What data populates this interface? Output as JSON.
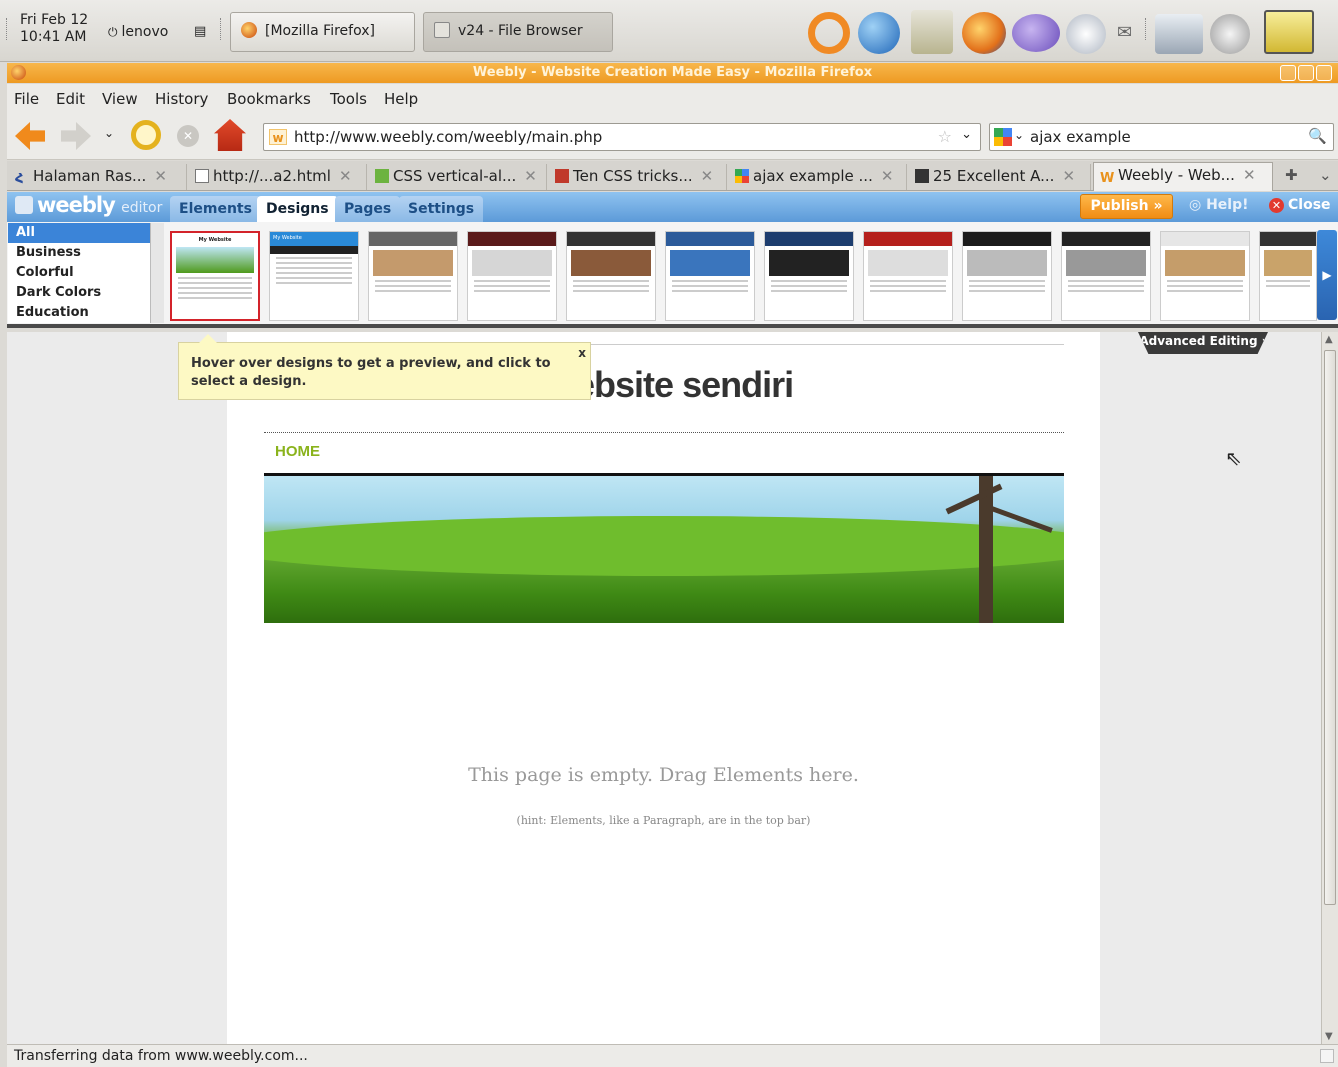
{
  "panel": {
    "clock_line1": "Fri Feb 12",
    "clock_line2": "10:41 AM",
    "user": "lenovo",
    "tasks": [
      "[Mozilla Firefox]",
      "v24 - File Browser"
    ]
  },
  "window": {
    "title": "Weebly - Website Creation Made Easy - Mozilla Firefox"
  },
  "menu": [
    "File",
    "Edit",
    "View",
    "History",
    "Bookmarks",
    "Tools",
    "Help"
  ],
  "nav": {
    "url": "http://www.weebly.com/weebly/main.php",
    "search": "ajax example"
  },
  "tabs": [
    {
      "label": "Halaman Ras...",
      "selected": false
    },
    {
      "label": "http://...a2.html",
      "selected": false
    },
    {
      "label": "CSS vertical-al...",
      "selected": false
    },
    {
      "label": "Ten CSS tricks...",
      "selected": false
    },
    {
      "label": "ajax example ...",
      "selected": false
    },
    {
      "label": "25 Excellent A...",
      "selected": false
    },
    {
      "label": "Weebly - Web...",
      "selected": true
    }
  ],
  "weebly": {
    "logo": "weebly",
    "logo_suffix": "editor",
    "tabs": [
      "Elements",
      "Designs",
      "Pages",
      "Settings"
    ],
    "publish": "Publish »",
    "help": "Help!",
    "close": "Close",
    "categories": [
      "All",
      "Business",
      "Colorful",
      "Dark Colors",
      "Education"
    ],
    "thumb_titles": [
      "My Website",
      "My Website"
    ],
    "advanced_editing": "Advanced Editing ›",
    "tooltip": "Hover over designs to get a preview, and click to select a design.",
    "tooltip_close": "x"
  },
  "site": {
    "title": "vebsite sendiri",
    "nav_home": "HOME",
    "empty_msg": "This page is empty. Drag Elements here.",
    "empty_hint": "(hint: Elements, like a Paragraph, are in the top bar)"
  },
  "status": {
    "text": "Transferring data from www.weebly.com..."
  }
}
